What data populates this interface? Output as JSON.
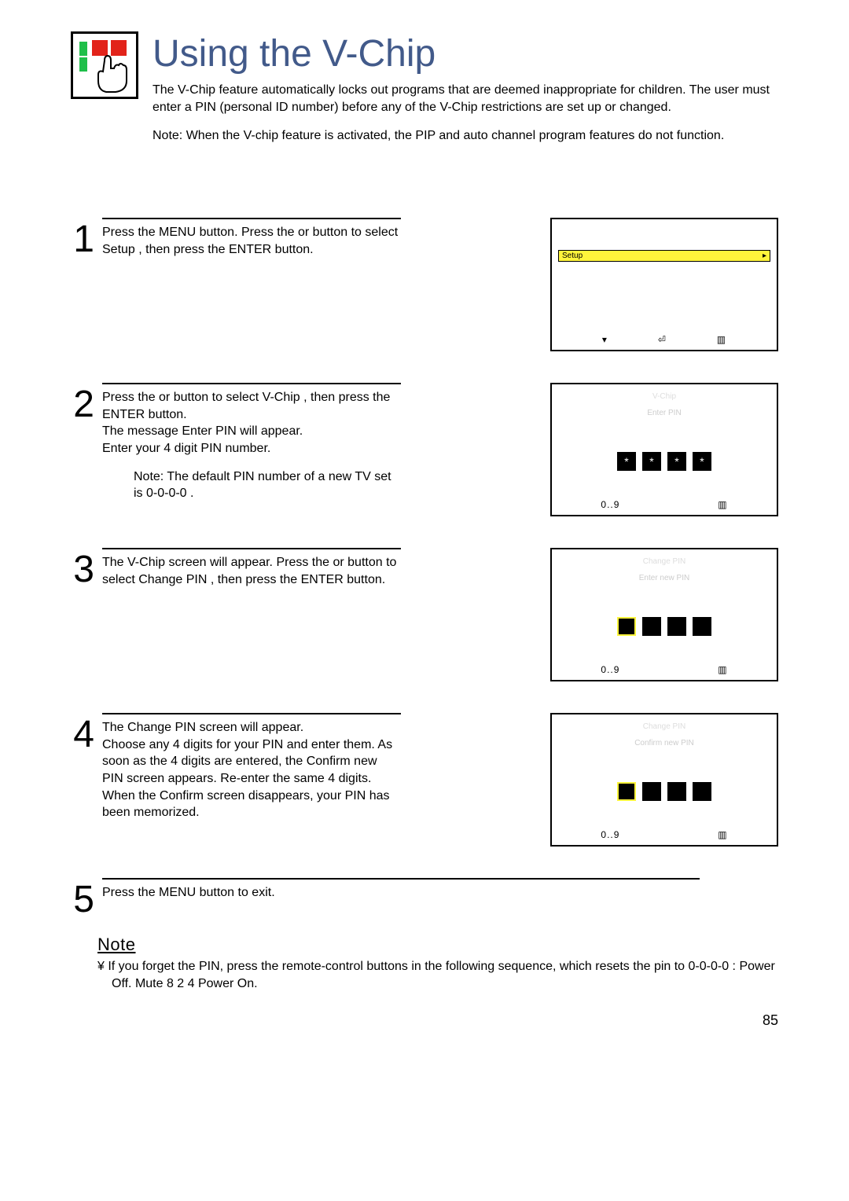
{
  "header": {
    "title": "Using the V-Chip",
    "intro": "The V-Chip feature automatically locks out programs that are deemed inappropriate for children. The user must enter a PIN (personal ID number) before any of the V-Chip restrictions are set up or changed.",
    "intro_note": "Note: When the V-chip feature is activated, the PIP and auto channel program features do not function."
  },
  "steps": {
    "s1": {
      "num": "1",
      "text": "Press the MENU button. Press the   or       button to select  Setup , then press the ENTER button.",
      "screen": {
        "sel_label": "Setup",
        "sel_arrow": "▸",
        "foot_a": "▾",
        "foot_b": "⏎",
        "foot_c": "▥"
      }
    },
    "s2": {
      "num": "2",
      "text": "Press the     or      button to select  V-Chip , then press the ENTER button.\nThe message  Enter PIN  will appear.\nEnter your 4 digit PIN number.",
      "subnote": "Note: The default PIN number of a new TV set is  0-0-0-0 .",
      "screen": {
        "title": "V-Chip",
        "line1": "Enter PIN",
        "stars": [
          "*",
          "*",
          "*",
          "*"
        ],
        "foot_a": "0..9",
        "foot_b": "▥"
      }
    },
    "s3": {
      "num": "3",
      "text": "The  V-Chip  screen will appear. Press the     or     button to select  Change PIN , then press the ENTER button.",
      "screen": {
        "title": "Change PIN",
        "line1": "Enter new PIN",
        "foot_a": "0..9",
        "foot_b": "▥"
      }
    },
    "s4": {
      "num": "4",
      "text": "The Change PIN screen will appear.\nChoose any 4 digits for your PIN and enter them. As soon as the 4 digits are entered, the  Confirm new PIN  screen appears. Re-enter the same 4 digits. When the Confirm screen disappears, your PIN has been memorized.",
      "screen": {
        "title": "Change PIN",
        "line1": "Confirm new PIN",
        "foot_a": "0..9",
        "foot_b": "▥"
      }
    },
    "s5": {
      "num": "5",
      "text": "Press the MENU button to exit."
    }
  },
  "note": {
    "head": "Note",
    "body": "¥   If you forget the PIN, press the remote-control buttons in the following sequence, which resets the pin to 0-0-0-0 : Power Off.      Mute      8      2      4      Power On."
  },
  "page_number": "85"
}
